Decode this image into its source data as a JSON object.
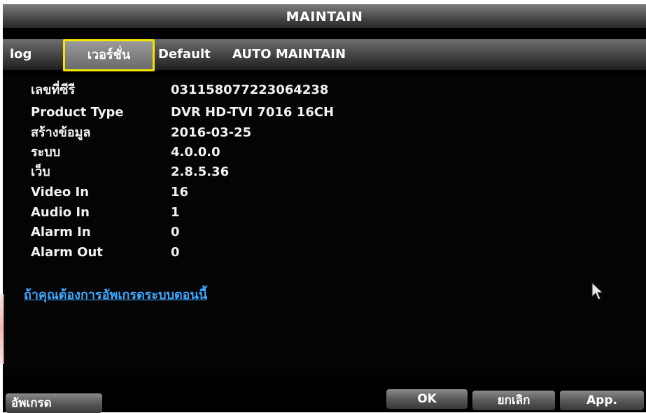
{
  "window": {
    "title": "MAINTAIN"
  },
  "tabs": {
    "log": "log",
    "version": "เวอร์ชั่น",
    "default": "Default",
    "auto_maintain": "AUTO MAINTAIN"
  },
  "info": [
    {
      "label": "เลขที่ซีรี",
      "value": "031158077223064238"
    },
    {
      "label": "Product Type",
      "value": "DVR HD-TVI 7016 16CH"
    },
    {
      "label": "สร้างข้อมูล",
      "value": "2016-03-25"
    },
    {
      "label": "ระบบ",
      "value": "4.0.0.0"
    },
    {
      "label": "เว็บ",
      "value": "2.8.5.36"
    },
    {
      "label": "Video In",
      "value": "16"
    },
    {
      "label": "Audio In",
      "value": "1"
    },
    {
      "label": "Alarm In",
      "value": "0"
    },
    {
      "label": "Alarm Out",
      "value": "0"
    }
  ],
  "upgrade_hint": "ถ้าคุณต้องการอัพเกรดระบบตอนนี้",
  "buttons": {
    "upgrade": "อัพเกรด",
    "ok": "OK",
    "cancel": "ยกเลิก",
    "apply": "App."
  },
  "colors": {
    "highlight_border": "#f2e600",
    "link": "#3da8ff",
    "background": "#000000"
  },
  "icons": {
    "cursor": "mouse-pointer-icon"
  }
}
